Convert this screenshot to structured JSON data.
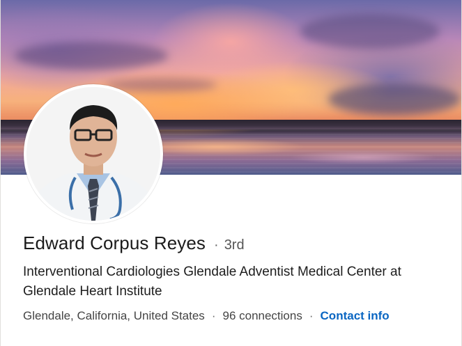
{
  "profile": {
    "name": "Edward Corpus Reyes",
    "separator": "·",
    "degree": "3rd",
    "headline": "Interventional Cardiologies Glendale Adventist Medical Center at Glendale Heart Institute",
    "location": "Glendale, California, United States",
    "connections": "96 connections",
    "contact_info": "Contact info"
  },
  "images": {
    "banner": "sunset-lake-banner",
    "avatar": "profile-photo"
  },
  "colors": {
    "link": "#0a66c2",
    "text_primary": "#1b1b1b",
    "text_secondary": "#444444"
  }
}
